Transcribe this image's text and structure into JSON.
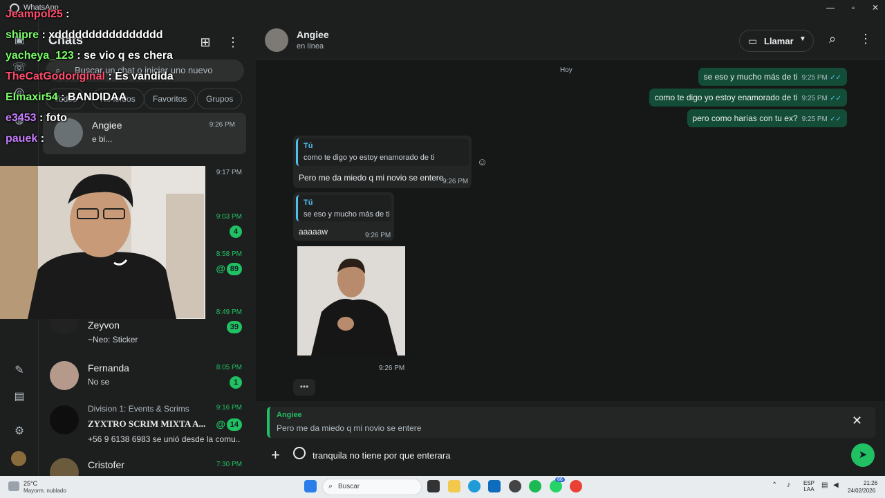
{
  "window": {
    "title": "WhatsApp"
  },
  "sidebar": {
    "title": "Chats",
    "search_placeholder": "Buscar un chat o iniciar uno nuevo",
    "filters": [
      "Todos",
      "No leídos",
      "Favoritos",
      "Grupos"
    ],
    "chats": [
      {
        "name": "Angiee",
        "time": "9:26 PM",
        "preview": "e bi...",
        "unread": "",
        "mention": false,
        "green": false
      },
      {
        "name": "",
        "time": "9:17 PM",
        "preview": "",
        "unread": "",
        "mention": false,
        "green": false
      },
      {
        "name": "",
        "time": "9:03 PM",
        "preview": "",
        "unread": "4",
        "mention": false,
        "green": true
      },
      {
        "name": "",
        "time": "8:58 PM",
        "preview": "",
        "unread": "89",
        "mention": true,
        "green": true
      },
      {
        "name": "Zeyvon",
        "time": "8:49 PM",
        "preview": "~Neo: Sticker",
        "unread": "39",
        "mention": false,
        "green": true
      },
      {
        "name": "Fernanda",
        "time": "8:05 PM",
        "preview": "No se",
        "unread": "1",
        "mention": false,
        "green": true
      },
      {
        "name": "Division 1: Events & Scrims",
        "subname": "ZYXTRO SCRIM MIXTA A...",
        "time": "9:16 PM",
        "preview": "+56 9 6138 6983 se unió desde la comu...",
        "unread": "14",
        "mention": true,
        "green": true
      },
      {
        "name": "Cristofer",
        "time": "7:30 PM",
        "preview": "",
        "unread": "",
        "mention": false,
        "green": true
      }
    ]
  },
  "stream_overlay": [
    {
      "user": "Jeampol25",
      "msg": ":",
      "color": "#ff4d6d"
    },
    {
      "user": "shipre",
      "msg": ": xdddddddddddddddd",
      "color": "#7cfc6b"
    },
    {
      "user": "yacheya_123",
      "msg": ": se vio q es chera",
      "color": "#7cfc6b"
    },
    {
      "user": "TheCatGodoriginal",
      "msg": ": Es vandida",
      "color": "#ff4d6d"
    },
    {
      "user": "Elmaxir54",
      "msg": ": BANDIDAA",
      "color": "#7cfc6b"
    },
    {
      "user": "e3453",
      "msg": ": foto",
      "color": "#c87dff"
    },
    {
      "user": "pauek",
      "msg": ":",
      "color": "#c87dff"
    }
  ],
  "conversation": {
    "name": "Angiee",
    "status": "en línea",
    "call_label": "Llamar",
    "day": "Hoy",
    "outgoing": [
      {
        "text": "se eso y mucho más de ti",
        "time": "9:25 PM"
      },
      {
        "text": "como te digo yo estoy enamorado de ti",
        "time": "9:25 PM"
      },
      {
        "text": "pero como harías con tu ex?",
        "time": "9:25 PM"
      }
    ],
    "incoming": [
      {
        "quote_author": "Tú",
        "quote_text": "como te digo yo estoy enamorado de ti",
        "text": "Pero me da miedo q mi novio se entere",
        "time": "9:26 PM"
      },
      {
        "quote_author": "Tú",
        "quote_text": "se eso y mucho más de ti",
        "text": "aaaaaw",
        "time": "9:26 PM"
      }
    ],
    "photo_time": "9:26 PM",
    "reply": {
      "author": "Angiee",
      "text": "Pero me da miedo q mi novio se entere"
    },
    "draft": "tranquila no tiene por que enterara"
  },
  "taskbar": {
    "weather_temp": "25°C",
    "weather_desc": "Mayorm. nublado",
    "search_placeholder": "Buscar",
    "lang": "ESP",
    "lang2": "LAA",
    "time": "21:26",
    "date": "24/02/2026",
    "badge": "66"
  },
  "colors": {
    "accent": "#21c063",
    "outgoing_bubble": "#144d37",
    "incoming_bubble": "#242626"
  }
}
